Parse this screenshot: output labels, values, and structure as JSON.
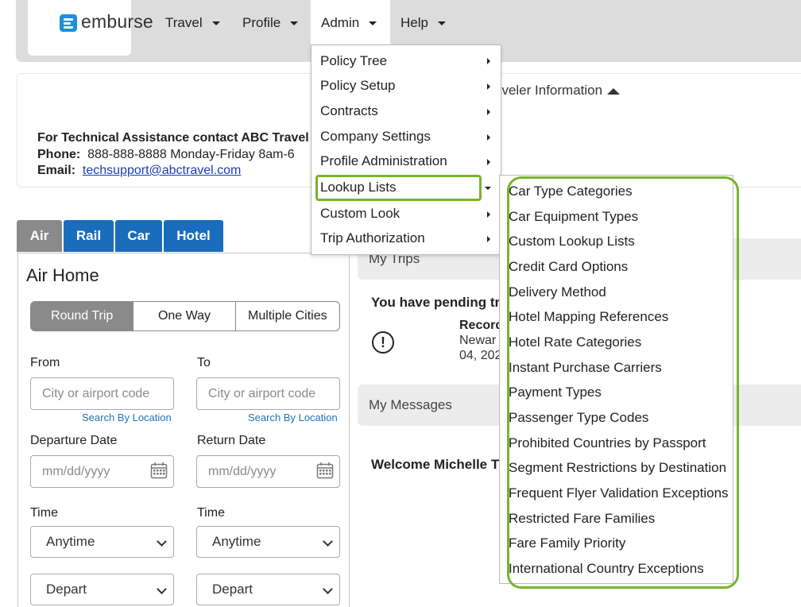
{
  "brand": {
    "name": "emburse",
    "accent": "#1e8fd8"
  },
  "nav": {
    "travel": "Travel",
    "profile": "Profile",
    "admin": "Admin",
    "help": "Help"
  },
  "info": {
    "traveler_info": "aveler Information",
    "tech_title": "For Technical Assistance contact ABC Travel",
    "phone_label": "Phone:",
    "phone_value": "888-888-8888 Monday-Friday 8am-6",
    "email_label": "Email:",
    "email_value": "techsupport@abctravel.com"
  },
  "modes": [
    "Air",
    "Rail",
    "Car",
    "Hotel"
  ],
  "air": {
    "title": "Air Home",
    "trip_types": [
      "Round Trip",
      "One Way",
      "Multiple Cities"
    ],
    "from_label": "From",
    "to_label": "To",
    "from_placeholder": "City or airport code",
    "to_placeholder": "City or airport code",
    "search_by_location": "Search By Location",
    "departure_label": "Departure Date",
    "return_label": "Return Date",
    "date_placeholder": "mm/dd/yyyy",
    "time_label": "Time",
    "time_value": "Anytime",
    "depart_value": "Depart"
  },
  "trips": {
    "title": "My Trips",
    "pending": "You have pending tri",
    "record_label": "Record",
    "record_city": "Newar",
    "record_date": "04, 202"
  },
  "messages": {
    "title": "My Messages",
    "welcome": "Welcome Michelle Th"
  },
  "admin_menu": {
    "items": [
      "Policy Tree",
      "Policy Setup",
      "Contracts",
      "Company Settings",
      "Profile Administration",
      "Lookup Lists",
      "Custom Look",
      "Trip Authorization"
    ]
  },
  "lookup_menu": {
    "items": [
      "Car Type Categories",
      "Car Equipment Types",
      "Custom Lookup Lists",
      "Credit Card Options",
      "Delivery Method",
      "Hotel Mapping References",
      "Hotel Rate Categories",
      "Instant Purchase Carriers",
      "Payment Types",
      "Passenger Type Codes",
      "Prohibited Countries by Passport",
      "Segment Restrictions by Destination",
      "Frequent Flyer Validation Exceptions",
      "Restricted Fare Families",
      "Fare Family Priority",
      "International Country Exceptions"
    ]
  },
  "colors": {
    "highlight": "#7ab32e",
    "tab_blue": "#1a6dbd",
    "tab_active": "#8a8a8a"
  }
}
